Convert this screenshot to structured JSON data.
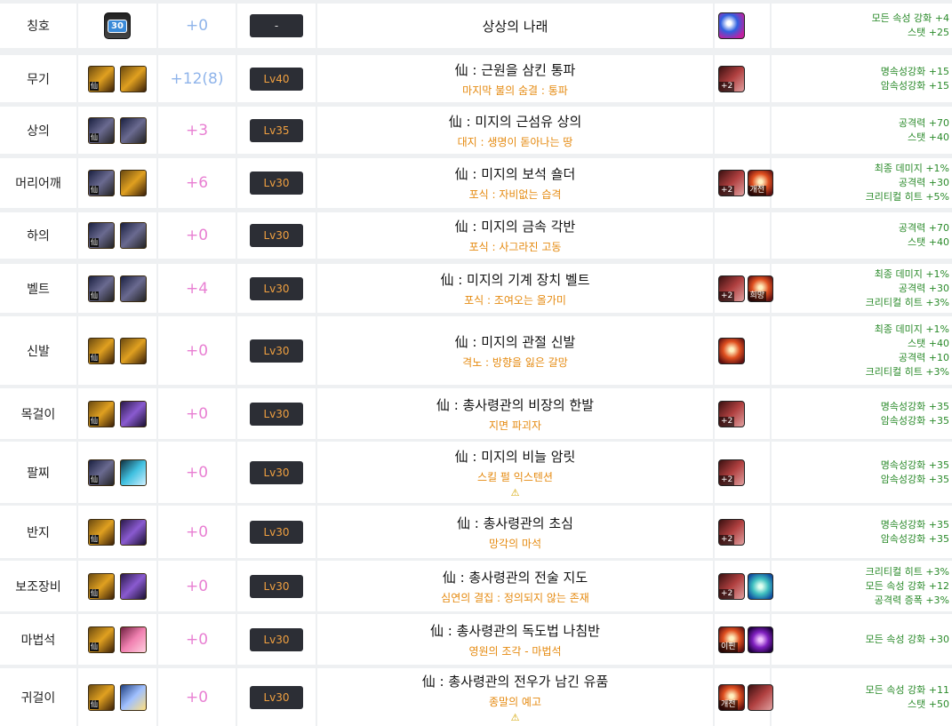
{
  "rows": [
    {
      "slot": "칭호",
      "enh": "+0",
      "enh_color": "blue",
      "lv": "-",
      "name": "상상의 나래",
      "sub": "",
      "warn": false,
      "icons": [
        "badge"
      ],
      "ext": [
        {
          "kind": "title-ext",
          "label": ""
        }
      ],
      "stats": [
        "모든 속성 강화 +4",
        "스탯 +25"
      ]
    },
    {
      "slot": "무기",
      "enh": "+12(8)",
      "enh_color": "blue",
      "lv": "Lv40",
      "name": "仙 : 근원을 삼킨 통파",
      "sub": "마지막 불의 숨결 : 통파",
      "warn": false,
      "icons": [
        "gold",
        "gold"
      ],
      "ext": [
        {
          "kind": "chest",
          "label": "+2"
        }
      ],
      "stats": [
        "명속성강화 +15",
        "암속성강화 +15"
      ]
    },
    {
      "slot": "상의",
      "enh": "+3",
      "enh_color": "pink",
      "lv": "Lv35",
      "name": "仙 : 미지의 근섬유 상의",
      "sub": "대지 : 생명이 돋아나는 땅",
      "warn": false,
      "icons": [
        "navy",
        "navy"
      ],
      "ext": [],
      "stats": [
        "공격력 +70",
        "스탯 +40"
      ]
    },
    {
      "slot": "머리어깨",
      "enh": "+6",
      "enh_color": "pink",
      "lv": "Lv30",
      "name": "仙 : 미지의 보석 숄더",
      "sub": "포식 : 자비없는 습격",
      "warn": false,
      "icons": [
        "navy",
        "gold"
      ],
      "ext": [
        {
          "kind": "chest",
          "label": "+2"
        },
        {
          "kind": "fire",
          "label": "개전"
        }
      ],
      "stats": [
        "최종 데미지 +1%",
        "공격력 +30",
        "크리티컬 히트 +5%"
      ]
    },
    {
      "slot": "하의",
      "enh": "+0",
      "enh_color": "pink",
      "lv": "Lv30",
      "name": "仙 : 미지의 금속 각반",
      "sub": "포식 : 사그라진 고동",
      "warn": false,
      "icons": [
        "navy",
        "navy"
      ],
      "ext": [],
      "stats": [
        "공격력 +70",
        "스탯 +40"
      ]
    },
    {
      "slot": "벨트",
      "enh": "+4",
      "enh_color": "pink",
      "lv": "Lv30",
      "name": "仙 : 미지의 기계 장치 벨트",
      "sub": "포식 : 조여오는 올가미",
      "warn": false,
      "icons": [
        "navy",
        "navy"
      ],
      "ext": [
        {
          "kind": "chest",
          "label": "+2"
        },
        {
          "kind": "fire",
          "label": "희망"
        }
      ],
      "stats": [
        "최종 데미지 +1%",
        "공격력 +30",
        "크리티컬 히트 +3%"
      ]
    },
    {
      "slot": "신발",
      "enh": "+0",
      "enh_color": "pink",
      "lv": "Lv30",
      "name": "仙 : 미지의 관절 신발",
      "sub": "격노 : 방향을 잃은 갈망",
      "warn": false,
      "icons": [
        "gold",
        "gold"
      ],
      "ext": [
        {
          "kind": "fire",
          "label": ""
        }
      ],
      "stats": [
        "최종 데미지 +1%",
        "스탯 +40",
        "공격력 +10",
        "크리티컬 히트 +3%"
      ]
    },
    {
      "slot": "목걸이",
      "enh": "+0",
      "enh_color": "pink",
      "lv": "Lv30",
      "name": "仙 : 총사령관의 비장의 한발",
      "sub": "지면 파괴자",
      "warn": false,
      "icons": [
        "gold",
        "purple"
      ],
      "ext": [
        {
          "kind": "chest",
          "label": "+2"
        }
      ],
      "stats": [
        "명속성강화 +35",
        "암속성강화 +35"
      ]
    },
    {
      "slot": "팔찌",
      "enh": "+0",
      "enh_color": "pink",
      "lv": "Lv30",
      "name": "仙 : 미지의 비늘 암릿",
      "sub": "스킬 펄 익스텐션",
      "warn": true,
      "icons": [
        "navy",
        "cyan"
      ],
      "ext": [
        {
          "kind": "chest",
          "label": "+2"
        }
      ],
      "stats": [
        "명속성강화 +35",
        "암속성강화 +35"
      ]
    },
    {
      "slot": "반지",
      "enh": "+0",
      "enh_color": "pink",
      "lv": "Lv30",
      "name": "仙 : 총사령관의 초심",
      "sub": "망각의 마석",
      "warn": false,
      "icons": [
        "gold",
        "purple"
      ],
      "ext": [
        {
          "kind": "chest",
          "label": "+2"
        }
      ],
      "stats": [
        "명속성강화 +35",
        "암속성강화 +35"
      ]
    },
    {
      "slot": "보조장비",
      "enh": "+0",
      "enh_color": "pink",
      "lv": "Lv30",
      "name": "仙 : 총사령관의 전술 지도",
      "sub": "심연의 결집 : 정의되지 않는 존재",
      "warn": false,
      "icons": [
        "gold",
        "purple"
      ],
      "ext": [
        {
          "kind": "chest",
          "label": "+2"
        },
        {
          "kind": "teal",
          "label": ""
        }
      ],
      "stats": [
        "크리티컬 히트 +3%",
        "모든 속성 강화 +12",
        "공격력 증폭 +3%"
      ]
    },
    {
      "slot": "마법석",
      "enh": "+0",
      "enh_color": "pink",
      "lv": "Lv30",
      "name": "仙 : 총사령관의 독도법 나침반",
      "sub": "영원의 조각 - 마법석",
      "warn": false,
      "icons": [
        "gold",
        "pink"
      ],
      "ext": [
        {
          "kind": "fire",
          "label": "이핀"
        },
        {
          "kind": "violet",
          "label": ""
        }
      ],
      "stats": [
        "모든 속성 강화 +30"
      ]
    },
    {
      "slot": "귀걸이",
      "enh": "+0",
      "enh_color": "pink",
      "lv": "Lv30",
      "name": "仙 : 총사령관의 전우가 남긴 유품",
      "sub": "종말의 예고",
      "warn": true,
      "icons": [
        "gold",
        "sky"
      ],
      "ext": [
        {
          "kind": "fire",
          "label": "개전"
        },
        {
          "kind": "chest",
          "label": ""
        }
      ],
      "stats": [
        "모든 속성 강화 +11",
        "스탯 +50"
      ]
    }
  ],
  "warn_symbol": "⚠",
  "sen_label": "仙",
  "badge_label": "30",
  "colors": {
    "enh_blue": "#8fb4ea",
    "enh_pink": "#e87fd2",
    "sub": "#e58a10",
    "stat": "#2a8a2a",
    "lv_text": "#f0a040"
  }
}
